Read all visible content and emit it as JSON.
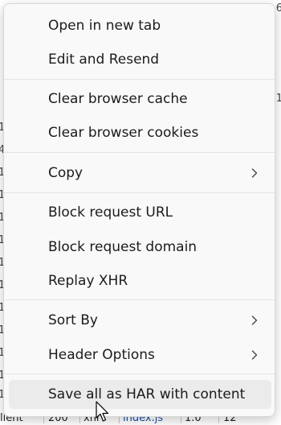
{
  "background": {
    "left_edge_glyphs": [
      "1",
      "4",
      "1",
      "1",
      "1",
      "1",
      "1",
      "1",
      "1",
      "1",
      "1",
      "1",
      "1"
    ],
    "right_edge_glyphs": [
      "6",
      "1"
    ],
    "bottom_row": {
      "client": "lient",
      "status": "200",
      "type": "xhr",
      "initiator": "index.js",
      "size": "1.0",
      "time": "12"
    }
  },
  "menu": {
    "items": [
      {
        "label": "Open in new tab"
      },
      {
        "label": "Edit and Resend"
      },
      {
        "label": "Clear browser cache"
      },
      {
        "label": "Clear browser cookies"
      },
      {
        "label": "Copy",
        "submenu": true
      },
      {
        "label": "Block request URL"
      },
      {
        "label": "Block request domain"
      },
      {
        "label": "Replay XHR"
      },
      {
        "label": "Sort By",
        "submenu": true
      },
      {
        "label": "Header Options",
        "submenu": true
      },
      {
        "label": "Save all as HAR with content",
        "highlighted": true
      }
    ]
  },
  "colors": {
    "menu_bg": "#f9f9f9",
    "highlight": "#ebebeb",
    "text": "#1b1b1b",
    "link": "#1a4fa8"
  }
}
